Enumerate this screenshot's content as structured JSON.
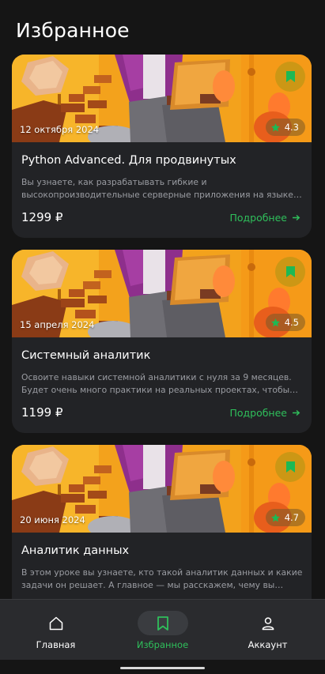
{
  "page": {
    "title": "Избранное"
  },
  "colors": {
    "accent": "#2fbf5b",
    "background": "#151515",
    "card": "#222326",
    "bookmark": "#c9a216"
  },
  "cards": [
    {
      "date": "12 октября 2024",
      "rating": "4.3",
      "title": "Python Advanced. Для продвинутых",
      "description": "Вы узнаете, как разрабатывать гибкие и высокопроизводительные серверные приложения на языке …",
      "price": "1299 ₽",
      "more": "Подробнее",
      "bookmarked": true
    },
    {
      "date": "15 апреля 2024",
      "rating": "4.5",
      "title": "Системный аналитик",
      "description": "Освоите навыки системной аналитики с нуля за 9 месяцев. Будет очень много практики на реальных проектах, чтобы вы…",
      "price": "1199 ₽",
      "more": "Подробнее",
      "bookmarked": true
    },
    {
      "date": "20 июня 2024",
      "rating": "4.7",
      "title": "Аналитик данных",
      "description": "В этом уроке вы узнаете, кто такой аналитик данных и какие задачи он решает. А главное — мы расскажем, чему вы научи…",
      "price": "",
      "more": "",
      "bookmarked": true
    }
  ],
  "nav": [
    {
      "label": "Главная",
      "icon": "home-icon",
      "active": false
    },
    {
      "label": "Избранное",
      "icon": "bookmark-icon",
      "active": true
    },
    {
      "label": "Аккаунт",
      "icon": "user-icon",
      "active": false
    }
  ]
}
